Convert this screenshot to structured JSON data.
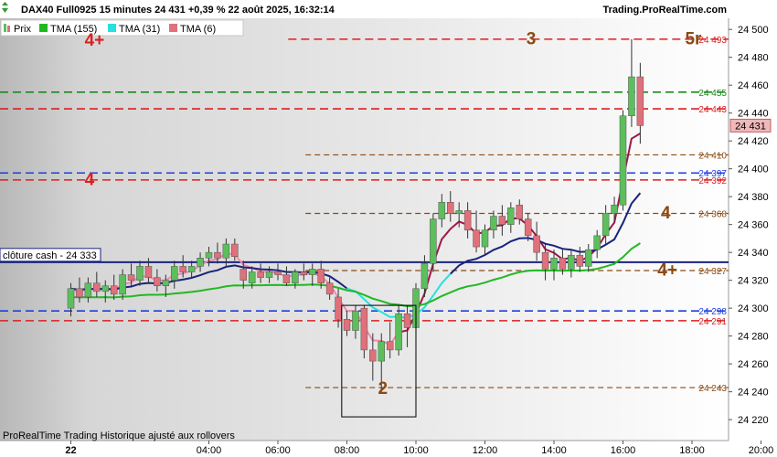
{
  "header": {
    "title": "DAX40 Full0925 15 minutes 24 431 +0,39 % 22 août 2025, 16:32:14",
    "brand": "Trading.ProRealTime.com"
  },
  "footer": "ProRealTime Trading  Historique ajusté aux rollovers",
  "colors": {
    "up": "#5cbf5c",
    "down": "#e0707a",
    "red_level": "#dd1f1f",
    "green_level": "#1a8a1a",
    "blue_level": "#1f3fdd",
    "brown_level": "#8a4a12",
    "navy": "#1a237e",
    "tma155": "#22b822",
    "tma31": "#28e0e0",
    "tma6_dark": "#9b1845",
    "tma6_light": "#f08aa8"
  },
  "chart_data": {
    "type": "candlestick",
    "title": "DAX40 Full0925 15 minutes 24 431 +0,39 % 22 août 2025, 16:32:14",
    "legend": [
      {
        "label": "Prix",
        "icon": "candle-icon"
      },
      {
        "label": "TMA (155)",
        "color": "#22b822"
      },
      {
        "label": "TMA (31)",
        "color": "#28e0e0"
      },
      {
        "label": "TMA (6)",
        "color": "#e0707a"
      }
    ],
    "ylim": [
      24205,
      24508
    ],
    "y_ticks": [
      "24 500",
      "24 480",
      "24 460",
      "24 440",
      "24 420",
      "24 400",
      "24 380",
      "24 360",
      "24 340",
      "24 320",
      "24 300",
      "24 280",
      "24 260",
      "24 240",
      "24 220"
    ],
    "x_ticks": [
      {
        "label": "22",
        "bold": true,
        "t": 0
      },
      {
        "label": "04:00",
        "t": 4
      },
      {
        "label": "06:00",
        "t": 6
      },
      {
        "label": "08:00",
        "t": 8
      },
      {
        "label": "10:00",
        "t": 10
      },
      {
        "label": "12:00",
        "t": 12
      },
      {
        "label": "14:00",
        "t": 14
      },
      {
        "label": "16:00",
        "t": 16
      },
      {
        "label": "18:00",
        "t": 18
      },
      {
        "label": "20:00",
        "t": 20
      }
    ],
    "levels": [
      {
        "value": 24493,
        "color": "red",
        "label": "24 493",
        "from_t": 6.3
      },
      {
        "value": 24455,
        "color": "green",
        "label": "24 455",
        "from_t": 0
      },
      {
        "value": 24443,
        "color": "red",
        "label": "24 443",
        "from_t": 0
      },
      {
        "value": 24410,
        "color": "brown",
        "label": "24 410",
        "from_t": 6.8
      },
      {
        "value": 24397,
        "color": "blue",
        "label": "24 397",
        "from_t": 0
      },
      {
        "value": 24392,
        "color": "red",
        "label": "24 392",
        "from_t": 0
      },
      {
        "value": 24368,
        "color": "brown",
        "label": "24 368",
        "from_t": 6.8
      },
      {
        "value": 24327,
        "color": "brown",
        "label": "24 327",
        "from_t": 6.8
      },
      {
        "value": 24298,
        "color": "blue",
        "label": "24 298",
        "from_t": 0
      },
      {
        "value": 24291,
        "color": "red",
        "label": "24 291",
        "from_t": 0
      },
      {
        "value": 24243,
        "color": "brown",
        "label": "24 243",
        "from_t": 6.8
      }
    ],
    "last_price": "24 431",
    "close_cash": {
      "label": "clôture cash -  24 333",
      "value": 24333
    },
    "annotations": [
      {
        "text": "4+",
        "color": "red",
        "t": 0.4,
        "y": 24493
      },
      {
        "text": "4",
        "color": "red",
        "t": 0.4,
        "y": 24393
      },
      {
        "text": "3",
        "color": "brown",
        "t": 13.2,
        "y": 24494
      },
      {
        "text": "5r",
        "color": "brown",
        "t": 17.8,
        "y": 24494
      },
      {
        "text": "5r",
        "color": "green",
        "t": 20.7,
        "y": 24453
      },
      {
        "text": "4",
        "color": "brown",
        "t": 17.1,
        "y": 24369
      },
      {
        "text": "4+",
        "color": "brown",
        "t": 17.0,
        "y": 24328
      },
      {
        "text": "2",
        "color": "brown",
        "t": 8.9,
        "y": 24243
      }
    ],
    "box": {
      "t0": 7.85,
      "t1": 10.0,
      "y_high": 24302,
      "y_low": 24222
    },
    "candles": [
      {
        "t": 0.0,
        "o": 24300,
        "h": 24318,
        "l": 24294,
        "c": 24314
      },
      {
        "t": 0.25,
        "o": 24314,
        "h": 24322,
        "l": 24304,
        "c": 24308
      },
      {
        "t": 0.5,
        "o": 24308,
        "h": 24322,
        "l": 24304,
        "c": 24318
      },
      {
        "t": 0.75,
        "o": 24318,
        "h": 24326,
        "l": 24308,
        "c": 24312
      },
      {
        "t": 1.0,
        "o": 24312,
        "h": 24320,
        "l": 24304,
        "c": 24316
      },
      {
        "t": 1.25,
        "o": 24316,
        "h": 24324,
        "l": 24306,
        "c": 24310
      },
      {
        "t": 1.5,
        "o": 24310,
        "h": 24328,
        "l": 24306,
        "c": 24324
      },
      {
        "t": 1.75,
        "o": 24324,
        "h": 24332,
        "l": 24316,
        "c": 24320
      },
      {
        "t": 2.0,
        "o": 24320,
        "h": 24334,
        "l": 24316,
        "c": 24330
      },
      {
        "t": 2.25,
        "o": 24330,
        "h": 24336,
        "l": 24318,
        "c": 24322
      },
      {
        "t": 2.5,
        "o": 24322,
        "h": 24328,
        "l": 24312,
        "c": 24316
      },
      {
        "t": 2.75,
        "o": 24316,
        "h": 24324,
        "l": 24308,
        "c": 24320
      },
      {
        "t": 3.0,
        "o": 24320,
        "h": 24334,
        "l": 24314,
        "c": 24330
      },
      {
        "t": 3.25,
        "o": 24330,
        "h": 24338,
        "l": 24322,
        "c": 24326
      },
      {
        "t": 3.5,
        "o": 24326,
        "h": 24334,
        "l": 24322,
        "c": 24330
      },
      {
        "t": 3.75,
        "o": 24330,
        "h": 24340,
        "l": 24326,
        "c": 24336
      },
      {
        "t": 4.0,
        "o": 24336,
        "h": 24344,
        "l": 24330,
        "c": 24340
      },
      {
        "t": 4.25,
        "o": 24340,
        "h": 24347,
        "l": 24332,
        "c": 24336
      },
      {
        "t": 4.5,
        "o": 24336,
        "h": 24350,
        "l": 24330,
        "c": 24346
      },
      {
        "t": 4.75,
        "o": 24346,
        "h": 24350,
        "l": 24334,
        "c": 24337
      },
      {
        "t": 5.0,
        "o": 24328,
        "h": 24334,
        "l": 24314,
        "c": 24320
      },
      {
        "t": 5.25,
        "o": 24318,
        "h": 24330,
        "l": 24314,
        "c": 24326
      },
      {
        "t": 5.5,
        "o": 24326,
        "h": 24332,
        "l": 24318,
        "c": 24322
      },
      {
        "t": 5.75,
        "o": 24322,
        "h": 24330,
        "l": 24318,
        "c": 24326
      },
      {
        "t": 6.0,
        "o": 24326,
        "h": 24332,
        "l": 24320,
        "c": 24324
      },
      {
        "t": 6.25,
        "o": 24324,
        "h": 24330,
        "l": 24316,
        "c": 24318
      },
      {
        "t": 6.5,
        "o": 24318,
        "h": 24328,
        "l": 24314,
        "c": 24326
      },
      {
        "t": 6.75,
        "o": 24326,
        "h": 24332,
        "l": 24320,
        "c": 24324
      },
      {
        "t": 7.0,
        "o": 24324,
        "h": 24332,
        "l": 24316,
        "c": 24328
      },
      {
        "t": 7.25,
        "o": 24328,
        "h": 24334,
        "l": 24314,
        "c": 24318
      },
      {
        "t": 7.5,
        "o": 24318,
        "h": 24322,
        "l": 24306,
        "c": 24310
      },
      {
        "t": 7.75,
        "o": 24308,
        "h": 24314,
        "l": 24286,
        "c": 24292
      },
      {
        "t": 8.0,
        "o": 24292,
        "h": 24298,
        "l": 24280,
        "c": 24284
      },
      {
        "t": 8.25,
        "o": 24284,
        "h": 24302,
        "l": 24278,
        "c": 24298
      },
      {
        "t": 8.5,
        "o": 24300,
        "h": 24302,
        "l": 24264,
        "c": 24270
      },
      {
        "t": 8.75,
        "o": 24270,
        "h": 24282,
        "l": 24248,
        "c": 24262
      },
      {
        "t": 9.0,
        "o": 24262,
        "h": 24282,
        "l": 24240,
        "c": 24276
      },
      {
        "t": 9.25,
        "o": 24276,
        "h": 24290,
        "l": 24264,
        "c": 24270
      },
      {
        "t": 9.5,
        "o": 24270,
        "h": 24302,
        "l": 24266,
        "c": 24296
      },
      {
        "t": 9.75,
        "o": 24296,
        "h": 24302,
        "l": 24272,
        "c": 24286
      },
      {
        "t": 10.0,
        "o": 24286,
        "h": 24318,
        "l": 24280,
        "c": 24314
      },
      {
        "t": 10.25,
        "o": 24314,
        "h": 24338,
        "l": 24308,
        "c": 24332
      },
      {
        "t": 10.5,
        "o": 24332,
        "h": 24368,
        "l": 24326,
        "c": 24364
      },
      {
        "t": 10.75,
        "o": 24364,
        "h": 24382,
        "l": 24358,
        "c": 24376
      },
      {
        "t": 11.0,
        "o": 24376,
        "h": 24384,
        "l": 24362,
        "c": 24368
      },
      {
        "t": 11.25,
        "o": 24368,
        "h": 24376,
        "l": 24358,
        "c": 24370
      },
      {
        "t": 11.5,
        "o": 24370,
        "h": 24376,
        "l": 24350,
        "c": 24356
      },
      {
        "t": 11.75,
        "o": 24356,
        "h": 24370,
        "l": 24340,
        "c": 24344
      },
      {
        "t": 12.0,
        "o": 24344,
        "h": 24360,
        "l": 24338,
        "c": 24356
      },
      {
        "t": 12.25,
        "o": 24356,
        "h": 24370,
        "l": 24350,
        "c": 24366
      },
      {
        "t": 12.5,
        "o": 24366,
        "h": 24374,
        "l": 24352,
        "c": 24360
      },
      {
        "t": 12.75,
        "o": 24360,
        "h": 24376,
        "l": 24354,
        "c": 24372
      },
      {
        "t": 13.0,
        "o": 24374,
        "h": 24378,
        "l": 24360,
        "c": 24364
      },
      {
        "t": 13.25,
        "o": 24364,
        "h": 24368,
        "l": 24348,
        "c": 24352
      },
      {
        "t": 13.5,
        "o": 24352,
        "h": 24362,
        "l": 24334,
        "c": 24340
      },
      {
        "t": 13.75,
        "o": 24340,
        "h": 24346,
        "l": 24320,
        "c": 24328
      },
      {
        "t": 14.0,
        "o": 24328,
        "h": 24342,
        "l": 24320,
        "c": 24336
      },
      {
        "t": 14.25,
        "o": 24336,
        "h": 24342,
        "l": 24324,
        "c": 24328
      },
      {
        "t": 14.5,
        "o": 24328,
        "h": 24342,
        "l": 24322,
        "c": 24338
      },
      {
        "t": 14.75,
        "o": 24338,
        "h": 24344,
        "l": 24326,
        "c": 24330
      },
      {
        "t": 15.0,
        "o": 24330,
        "h": 24346,
        "l": 24326,
        "c": 24342
      },
      {
        "t": 15.25,
        "o": 24342,
        "h": 24356,
        "l": 24336,
        "c": 24352
      },
      {
        "t": 15.5,
        "o": 24352,
        "h": 24374,
        "l": 24346,
        "c": 24368
      },
      {
        "t": 15.75,
        "o": 24368,
        "h": 24380,
        "l": 24362,
        "c": 24374
      },
      {
        "t": 16.0,
        "o": 24374,
        "h": 24442,
        "l": 24370,
        "c": 24438
      },
      {
        "t": 16.25,
        "o": 24438,
        "h": 24493,
        "l": 24430,
        "c": 24466
      },
      {
        "t": 16.5,
        "o": 24466,
        "h": 24476,
        "l": 24418,
        "c": 24431
      }
    ]
  }
}
